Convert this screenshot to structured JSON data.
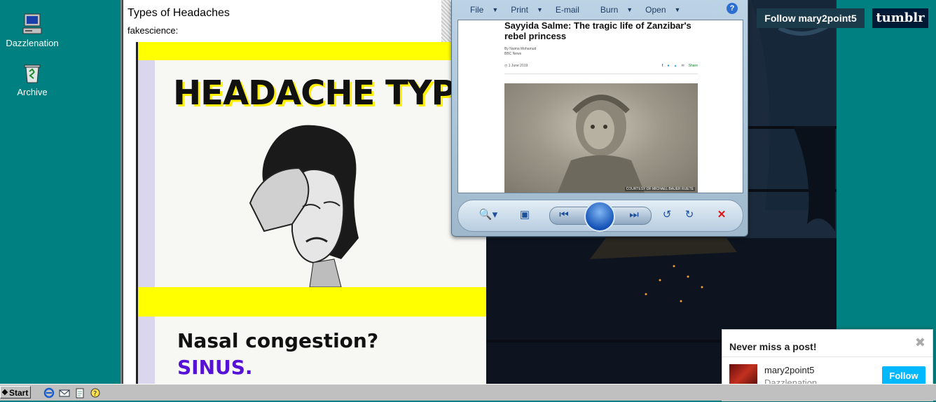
{
  "desktop": {
    "icons": [
      {
        "label": "Dazzlenation",
        "icon": "computer-icon"
      },
      {
        "label": "Archive",
        "icon": "recycle-bin-icon"
      }
    ]
  },
  "post": {
    "title": "Types of Headaches",
    "source": "fakescience:",
    "poster": {
      "headline": "HEADACHE TYPES",
      "question": "Nasal congestion?",
      "answer": "SINUS.",
      "colors": {
        "band": "#ffff00",
        "answer": "#5512d6"
      }
    }
  },
  "viewer": {
    "menu": [
      {
        "label": "File",
        "dropdown": true
      },
      {
        "label": "Print",
        "dropdown": true
      },
      {
        "label": "E-mail",
        "dropdown": false
      },
      {
        "label": "Burn",
        "dropdown": true
      },
      {
        "label": "Open",
        "dropdown": true
      }
    ],
    "article": {
      "title": "Sayyida Salme: The tragic life of Zanzibar's rebel princess",
      "byline": "By Naima Mohamud",
      "outlet": "BBC News",
      "date": "1 June 2019",
      "share_label": "Share",
      "credit": "COURTESY OF MICHAEL BAUER RUETE"
    },
    "controls": [
      "zoom-icon",
      "fit-window-icon",
      "previous-icon",
      "slideshow-icon",
      "next-icon",
      "rotate-left-icon",
      "rotate-right-icon",
      "delete-icon"
    ]
  },
  "tumblr": {
    "follow_banner": "Follow mary2point5",
    "logo": "tumblr",
    "popup": {
      "title": "Never miss a post!",
      "blog_name": "mary2point5",
      "blog_title": "Dazzlenation",
      "follow_label": "Follow"
    }
  },
  "taskbar": {
    "start_label": "Start"
  }
}
